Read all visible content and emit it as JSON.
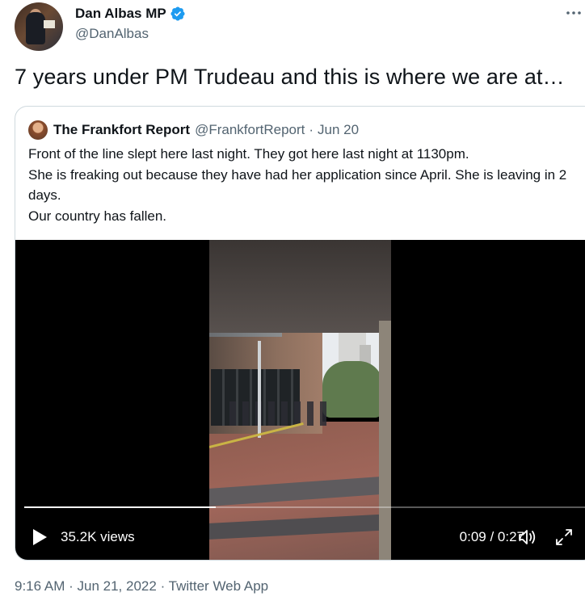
{
  "author": {
    "display_name": "Dan Albas MP",
    "handle": "@DanAlbas",
    "verified": true
  },
  "tweet": {
    "text": "7 years under PM Trudeau and this is where we are at…"
  },
  "quoted_tweet": {
    "display_name": "The Frankfort Report",
    "handle": "@FrankfortReport",
    "separator": "·",
    "date": "Jun 20",
    "lines": [
      "Front of the line slept here last night. They got here last night at 1130pm.",
      "She is freaking out because they have had her application since April. She is leaving in 2 days.",
      "Our country has fallen."
    ],
    "video": {
      "views": "35.2K views",
      "time": "0:09 / 0:27",
      "progress": 0.34
    }
  },
  "meta": {
    "time": "9:16 AM",
    "separator": "·",
    "date": "Jun 21, 2022",
    "source": "Twitter Web App"
  },
  "colors": {
    "verified_blue": "#1d9bf0",
    "secondary_text": "#536471",
    "border": "#cfd9de"
  }
}
